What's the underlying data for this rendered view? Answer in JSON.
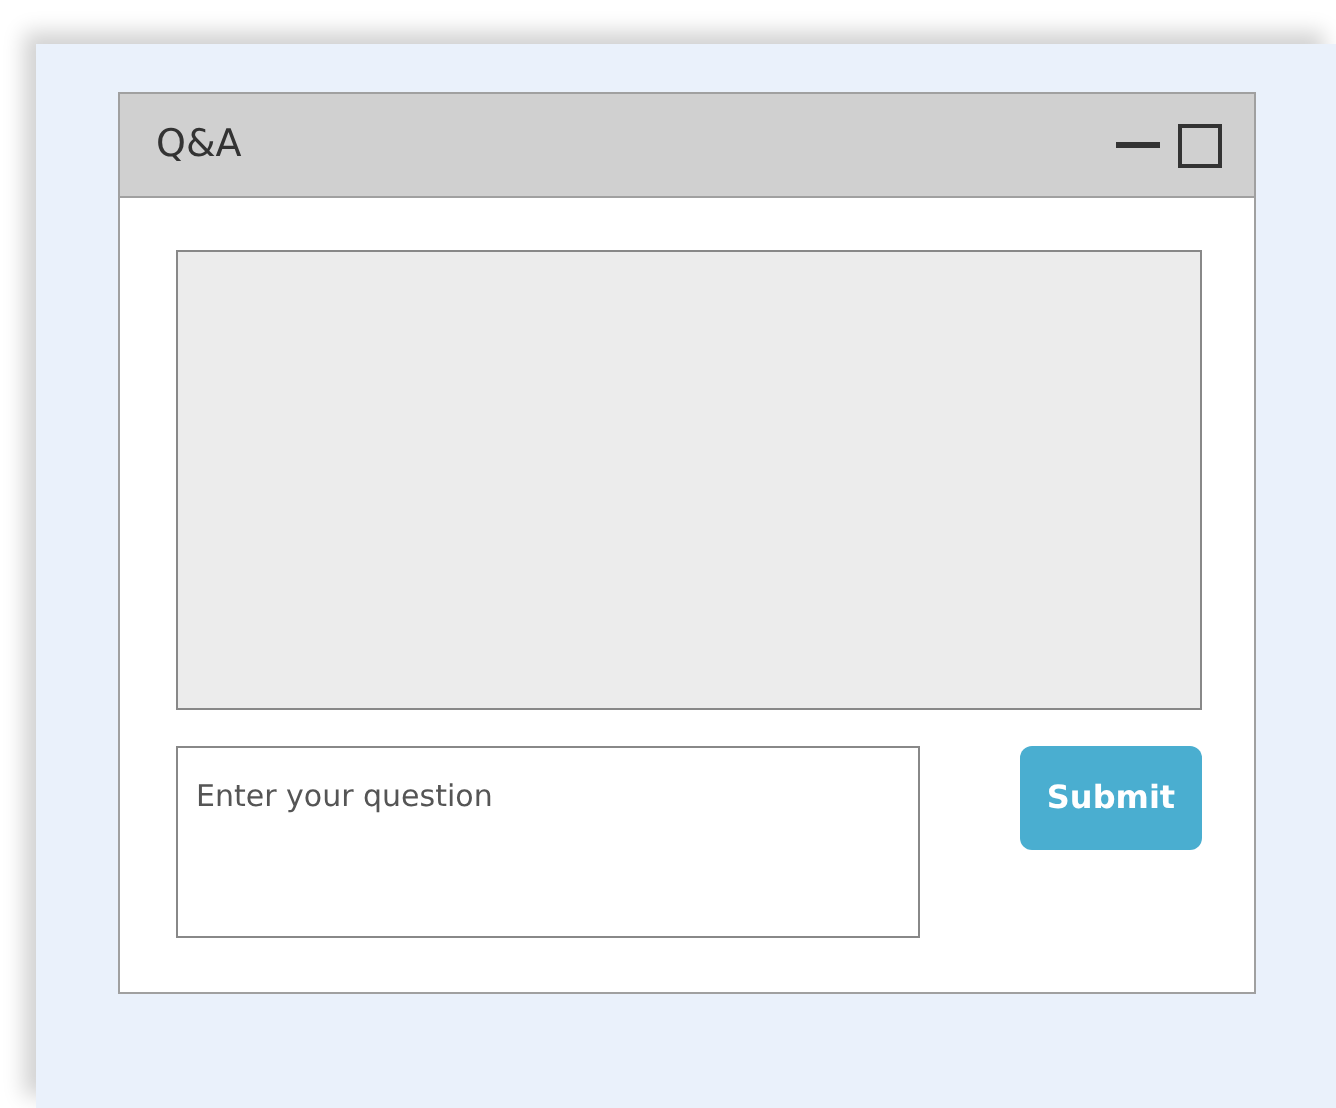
{
  "window": {
    "title": "Q&A"
  },
  "question": {
    "placeholder": "Enter your question"
  },
  "buttons": [
    "Submit"
  ]
}
